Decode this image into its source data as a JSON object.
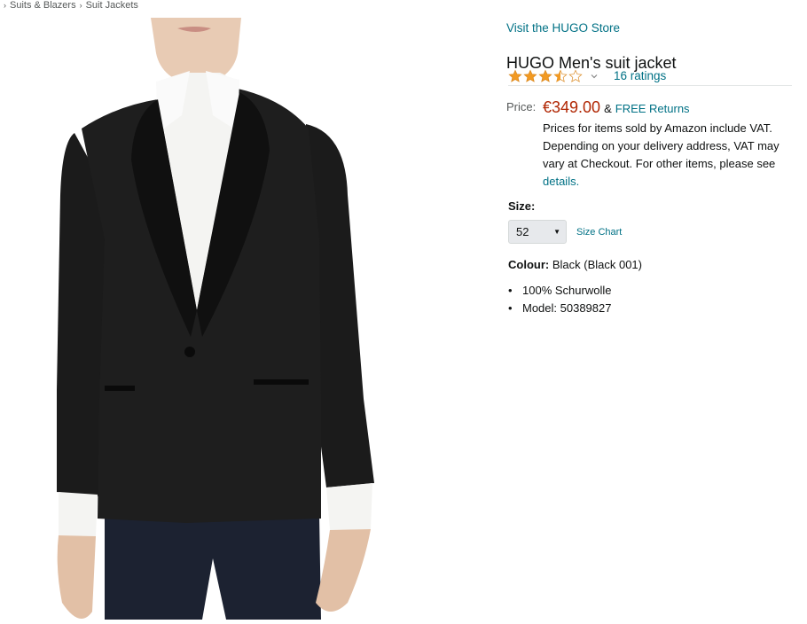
{
  "breadcrumb": [
    "Suits & Blazers",
    "Suit Jackets"
  ],
  "product": {
    "store_link": "Visit the HUGO Store",
    "title": "HUGO Men's suit jacket",
    "rating": 3.5,
    "rating_max": 5,
    "ratings_count_label": "16 ratings",
    "price_label": "Price:",
    "price": "€349.00",
    "price_amp": "&",
    "free_returns": "FREE Returns",
    "vat_note": "Prices for items sold by Amazon include VAT. Depending on your delivery address, VAT may vary at Checkout. For other items, please see",
    "details_link": "details.",
    "size_label": "Size:",
    "size_selected": "52",
    "size_chart": "Size Chart",
    "colour_label": "Colour:",
    "colour_value": "Black (Black 001)",
    "bullets": [
      "100% Schurwolle",
      "Model: 50389827"
    ]
  },
  "icons": {
    "star": "star-icon",
    "chevron": "chevron-down-icon",
    "select_arrow": "dropdown-arrow-icon"
  },
  "colors": {
    "link": "#007185",
    "price": "#b12704",
    "star": "#f29a22",
    "text": "#0f1111",
    "muted": "#565959"
  }
}
